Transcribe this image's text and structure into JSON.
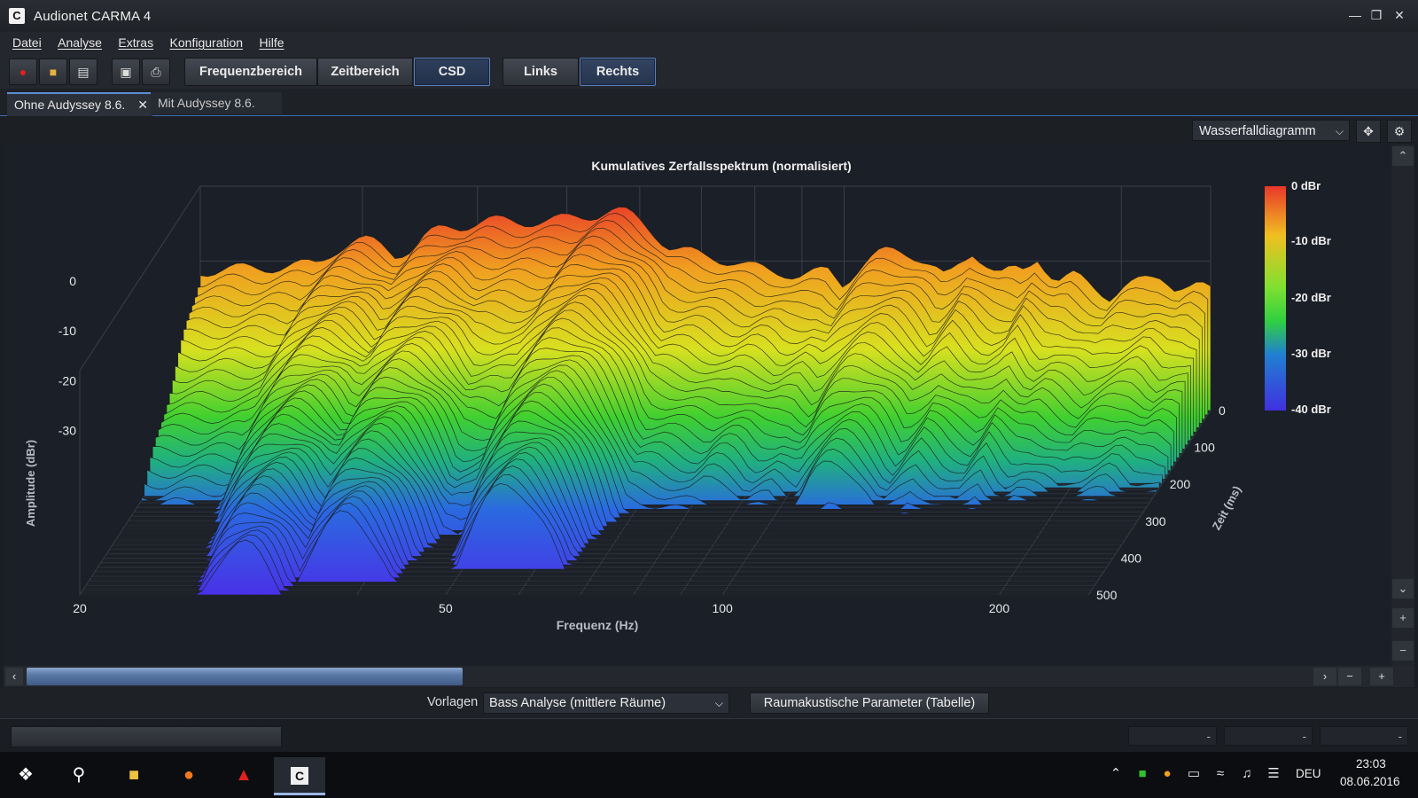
{
  "window": {
    "title": "Audionet CARMA 4",
    "icon_glyph": "C",
    "controls": [
      "minimize-icon",
      "restore-icon",
      "close-icon"
    ]
  },
  "menu": [
    "Datei",
    "Analyse",
    "Extras",
    "Konfiguration",
    "Hilfe"
  ],
  "toolbar": {
    "icons": [
      "record-icon",
      "open-folder-icon",
      "save-icon",
      "screenshot-icon",
      "print-icon"
    ],
    "view_buttons": [
      "Frequenzbereich",
      "Zeitbereich",
      "CSD"
    ],
    "active_view": "CSD",
    "channel_buttons": [
      "Links",
      "Rechts"
    ]
  },
  "doc_tabs": {
    "active": "Ohne Audyssey 8.6.",
    "inactive": "Mit Audyssey 8.6."
  },
  "view_selector": {
    "value": "Wasserfalldiagramm",
    "icons": [
      "move-icon",
      "gear-icon"
    ]
  },
  "chart_data": {
    "type": "waterfall",
    "title": "Kumulatives Zerfallsspektrum (normalisiert)",
    "xlabel": "Frequenz (Hz)",
    "ylabel": "Amplitude (dBr)",
    "zlabel": "Zeit (ms)",
    "x_scale": "log",
    "xlim": [
      20,
      250
    ],
    "x_ticks": [
      "20",
      "50",
      "100",
      "200"
    ],
    "y_ticks": [
      "0",
      "-10",
      "-20",
      "-30"
    ],
    "ylim": [
      -40,
      5
    ],
    "z_ticks": [
      "0",
      "100",
      "200",
      "300",
      "400",
      "500"
    ],
    "zlim": [
      0,
      500
    ],
    "colorbar": {
      "labels": [
        "0 dBr",
        "-10 dBr",
        "-20 dBr",
        "-30 dBr",
        "-40 dBr"
      ],
      "colors": [
        "#e8372a",
        "#f0a020",
        "#d8e020",
        "#30d030",
        "#20b080",
        "#2060e0",
        "#4030e0"
      ]
    },
    "initial_spectrum": {
      "freq_hz": [
        20,
        25,
        30,
        35,
        38,
        41,
        45,
        48,
        52,
        56,
        60,
        66,
        72,
        78,
        84,
        90,
        96,
        102,
        108,
        114,
        118,
        124,
        130,
        138,
        146,
        154,
        162,
        170,
        178,
        186,
        194,
        202,
        212,
        222,
        232,
        242,
        250
      ],
      "level_dbr": [
        -12,
        -11,
        -10,
        -7,
        -3,
        -2,
        -2,
        -2,
        -1,
        0,
        -5,
        -8,
        -9,
        -11,
        -12,
        -13,
        -12,
        -16,
        -14,
        -8,
        -10,
        -15,
        -13,
        -8,
        -12,
        -14,
        -9,
        -14,
        -13,
        -15,
        -17,
        -15,
        -14,
        -13,
        -16,
        -15,
        -16
      ]
    },
    "resonances": [
      {
        "freq_hz": 30,
        "decay_ms": 500,
        "peak_dbr": -6
      },
      {
        "freq_hz": 38,
        "decay_ms": 470,
        "peak_dbr": -3
      },
      {
        "freq_hz": 56,
        "decay_ms": 440,
        "peak_dbr": 0
      },
      {
        "freq_hz": 84,
        "decay_ms": 250,
        "peak_dbr": -12
      },
      {
        "freq_hz": 114,
        "decay_ms": 260,
        "peak_dbr": -8
      },
      {
        "freq_hz": 154,
        "decay_ms": 200,
        "peak_dbr": -12
      },
      {
        "freq_hz": 232,
        "decay_ms": 120,
        "peak_dbr": -15
      }
    ]
  },
  "presets": {
    "label": "Vorlagen",
    "value": "Bass Analyse (mittlere Räume)",
    "button": "Raumakustische Parameter (Tabelle)"
  },
  "status": {
    "cells": [
      "-",
      "-",
      "-"
    ]
  },
  "taskbar": {
    "apps": [
      "windows-start-icon",
      "search-icon",
      "file-explorer-icon",
      "firefox-icon",
      "acrobat-icon",
      "carma-icon"
    ],
    "lang": "DEU",
    "time": "23:03",
    "date": "08.06.2016"
  }
}
